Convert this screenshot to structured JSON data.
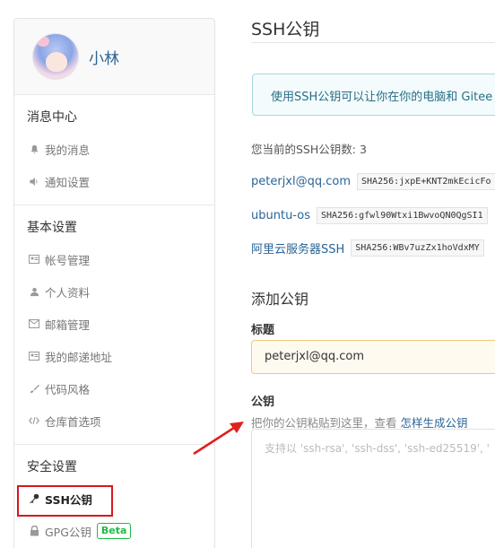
{
  "user": {
    "name": "小林"
  },
  "sidebar": {
    "sections": [
      {
        "title": "消息中心",
        "items": [
          {
            "label": "我的消息",
            "icon": "bell-icon"
          },
          {
            "label": "通知设置",
            "icon": "speaker-icon"
          }
        ]
      },
      {
        "title": "基本设置",
        "items": [
          {
            "label": "帐号管理",
            "icon": "id-card-icon"
          },
          {
            "label": "个人资料",
            "icon": "user-icon"
          },
          {
            "label": "邮箱管理",
            "icon": "mail-icon"
          },
          {
            "label": "我的邮递地址",
            "icon": "address-card-icon"
          },
          {
            "label": "代码风格",
            "icon": "brush-icon"
          },
          {
            "label": "仓库首选项",
            "icon": "code-icon"
          }
        ]
      },
      {
        "title": "安全设置",
        "items": [
          {
            "label": "SSH公钥",
            "icon": "key-icon",
            "active": true
          },
          {
            "label": "GPG公钥",
            "icon": "lock-icon",
            "badge": "Beta"
          }
        ]
      }
    ]
  },
  "main": {
    "title": "SSH公钥",
    "info": "使用SSH公钥可以让你在你的电脑和 Gitee",
    "count_text": "您当前的SSH公钥数: 3",
    "keys": [
      {
        "name": "peterjxl@qq.com",
        "hash": "SHA256:jxpE+KNT2mkEcicFo"
      },
      {
        "name": "ubuntu-os",
        "hash": "SHA256:gfwl90Wtxi1BwvoQN0QgSI1"
      },
      {
        "name": "阿里云服务器SSH",
        "hash": "SHA256:WBv7uzZx1hoVdxMY"
      }
    ],
    "add_title": "添加公钥",
    "title_label": "标题",
    "title_value": "peterjxl@qq.com",
    "key_label": "公钥",
    "hint_text": "把你的公钥粘贴到这里，查看",
    "hint_link": "怎样生成公钥",
    "textarea_placeholder": "支持以 'ssh-rsa', 'ssh-dss', 'ssh-ed25519', '"
  },
  "colors": {
    "highlight": "#d7191c",
    "link": "#2a6496",
    "beta": "#21ba45"
  }
}
